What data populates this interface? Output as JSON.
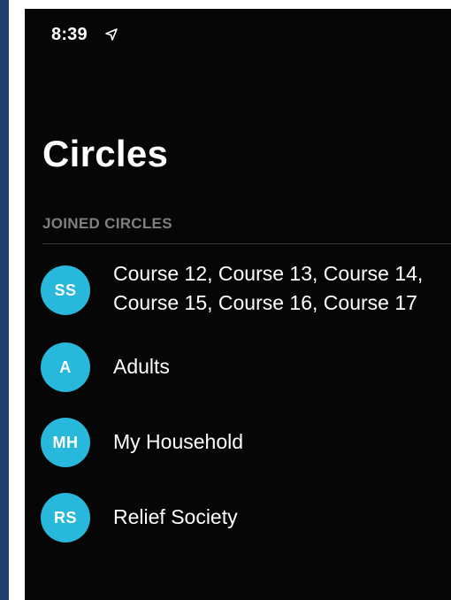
{
  "status_bar": {
    "time": "8:39",
    "location_icon": "location-arrow-icon"
  },
  "page": {
    "title": "Circles"
  },
  "section": {
    "header": "JOINED CIRCLES"
  },
  "circles": [
    {
      "initials": "SS",
      "label": "Course 12, Course 13, Course 14,\nCourse 15, Course 16, Course 17"
    },
    {
      "initials": "A",
      "label": "Adults"
    },
    {
      "initials": "MH",
      "label": "My Household"
    },
    {
      "initials": "RS",
      "label": "Relief Society"
    }
  ],
  "colors": {
    "background": "#060606",
    "avatar": "#27b8dc",
    "section_header": "#7f7f80",
    "text": "#ffffff"
  }
}
